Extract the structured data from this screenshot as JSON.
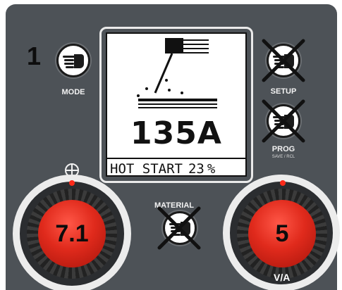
{
  "panel": {
    "step_number": "1",
    "display": {
      "current": "135A",
      "status_label": "HOT START",
      "status_value": "23",
      "status_unit": "%"
    },
    "buttons": {
      "mode": {
        "label": "MODE",
        "disabled": false
      },
      "setup": {
        "label": "SETUP",
        "disabled": true
      },
      "prog": {
        "label": "PROG",
        "sublabel": "SAVE / RCL",
        "disabled": true
      },
      "material": {
        "label": "MATERIAL",
        "disabled": true
      }
    },
    "knobs": {
      "left": {
        "value": "7.1",
        "color": "#e02a1c"
      },
      "right": {
        "value": "5",
        "label": "V/A",
        "color": "#e02a1c"
      }
    },
    "colors": {
      "panel": "#4d5257",
      "lcd_bg": "#ffffff",
      "accent_red": "#ff2a1a"
    }
  }
}
